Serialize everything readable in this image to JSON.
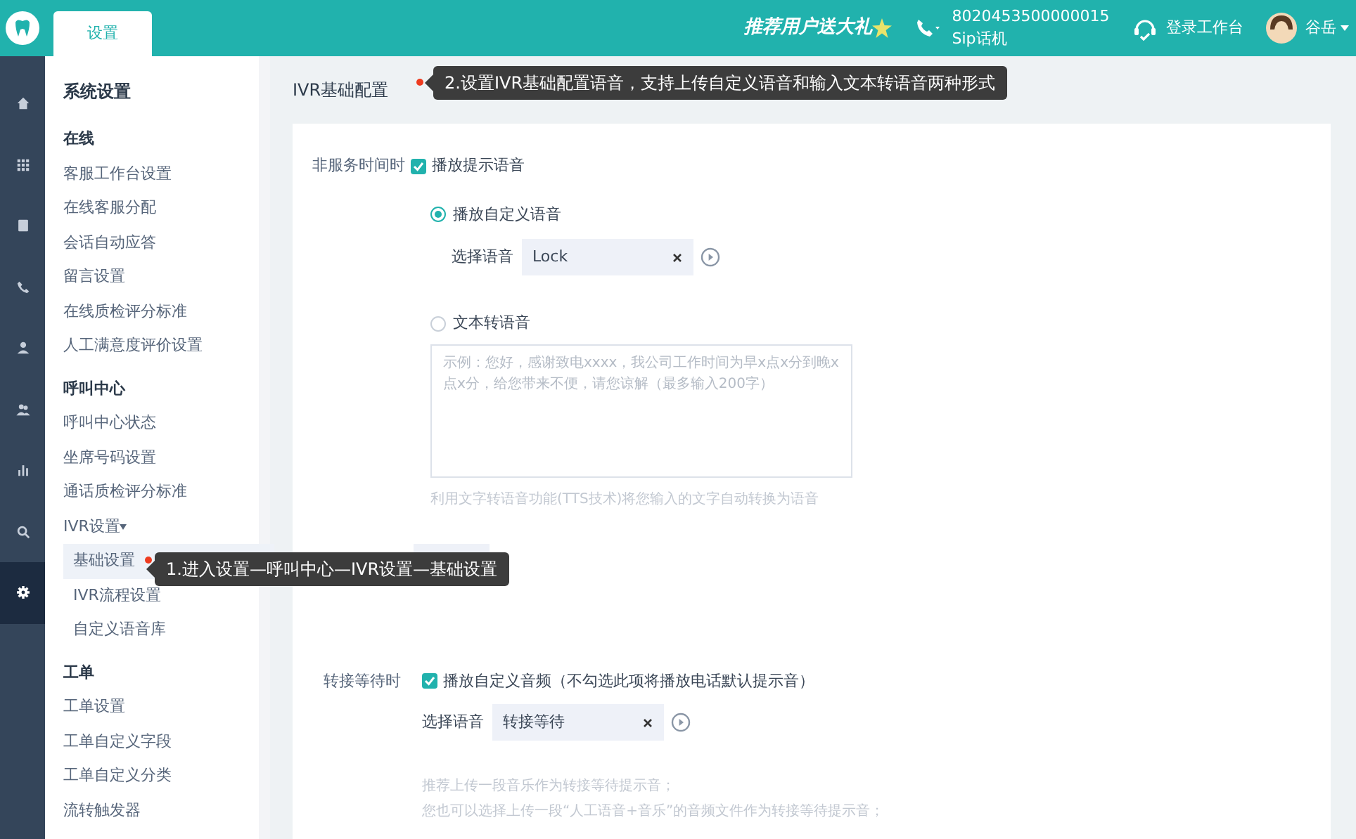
{
  "top_bar": {
    "tabs": [
      {
        "label": "设置",
        "selected": true
      }
    ],
    "promo": "推荐用户送大礼",
    "phone": {
      "number": "8020453500000015",
      "line": "Sip话机"
    },
    "login": "登录工作台",
    "user": "谷岳"
  },
  "rail": [
    {
      "kind": "home",
      "selected": false
    },
    {
      "kind": "apps",
      "selected": false
    },
    {
      "kind": "book",
      "selected": false
    },
    {
      "kind": "phone",
      "selected": false
    },
    {
      "kind": "person",
      "selected": false
    },
    {
      "kind": "people",
      "selected": false
    },
    {
      "kind": "chart",
      "selected": false
    },
    {
      "kind": "search",
      "selected": false
    },
    {
      "kind": "settings",
      "selected": true
    }
  ],
  "sidebar": {
    "title": "系统设置",
    "groups": [
      {
        "heading": "在线",
        "items": [
          {
            "label": "客服工作台设置",
            "selected": false
          },
          {
            "label": "在线客服分配",
            "selected": false
          },
          {
            "label": "会话自动应答",
            "selected": false
          },
          {
            "label": "留言设置",
            "selected": false
          },
          {
            "label": "在线质检评分标准",
            "selected": false
          },
          {
            "label": "人工满意度评价设置",
            "selected": false
          }
        ]
      },
      {
        "heading": "呼叫中心",
        "items": [
          {
            "label": "呼叫中心状态",
            "selected": false
          },
          {
            "label": "坐席号码设置",
            "selected": false
          },
          {
            "label": "通话质检评分标准",
            "selected": false
          },
          {
            "label": "IVR设置",
            "selected": false,
            "expanded": true,
            "children": [
              {
                "label": "基础设置",
                "selected": true
              },
              {
                "label": "IVR流程设置",
                "selected": false
              },
              {
                "label": "自定义语音库",
                "selected": false
              }
            ]
          }
        ]
      },
      {
        "heading": "工单",
        "items": [
          {
            "label": "工单设置",
            "selected": false
          },
          {
            "label": "工单自定义字段",
            "selected": false
          },
          {
            "label": "工单自定义分类",
            "selected": false
          },
          {
            "label": "流转触发器",
            "selected": false
          }
        ]
      }
    ]
  },
  "page": {
    "title": "IVR基础配置",
    "off_hours": {
      "label": "非服务时间时",
      "checkbox": {
        "label": "播放提示语音",
        "checked": true
      },
      "options": [
        {
          "kind": "voice",
          "label": "播放自定义语音",
          "selected": true,
          "select_label": "选择语音",
          "value": "Lock"
        },
        {
          "kind": "tts",
          "label": "文本转语音",
          "selected": false,
          "placeholder": "示例：您好，感谢致电xxxx，我公司工作时间为早x点x分到晚x点x分，给您带来不便，请您谅解（最多输入200字）",
          "hint": "利用文字转语音功能(TTS技术)将您输入的文字自动转换为语音"
        }
      ]
    },
    "transfer": {
      "label": "转接等待时",
      "checkbox": {
        "label": "播放自定义音频（不勾选此项将播放电话默认提示音）",
        "checked": true
      },
      "select_label": "选择语音",
      "value": "转接等待",
      "notes": [
        "推荐上传一段音乐作为转接等待提示音；",
        "您也可以选择上传一段“人工语音+音乐”的音频文件作为转接等待提示音；"
      ]
    }
  },
  "tooltips": [
    {
      "text": "1.进入设置—呼叫中心—IVR设置—基础设置"
    },
    {
      "text": "2.设置IVR基础配置语音，支持上传自定义语音和输入文本转语音两种形式"
    }
  ]
}
